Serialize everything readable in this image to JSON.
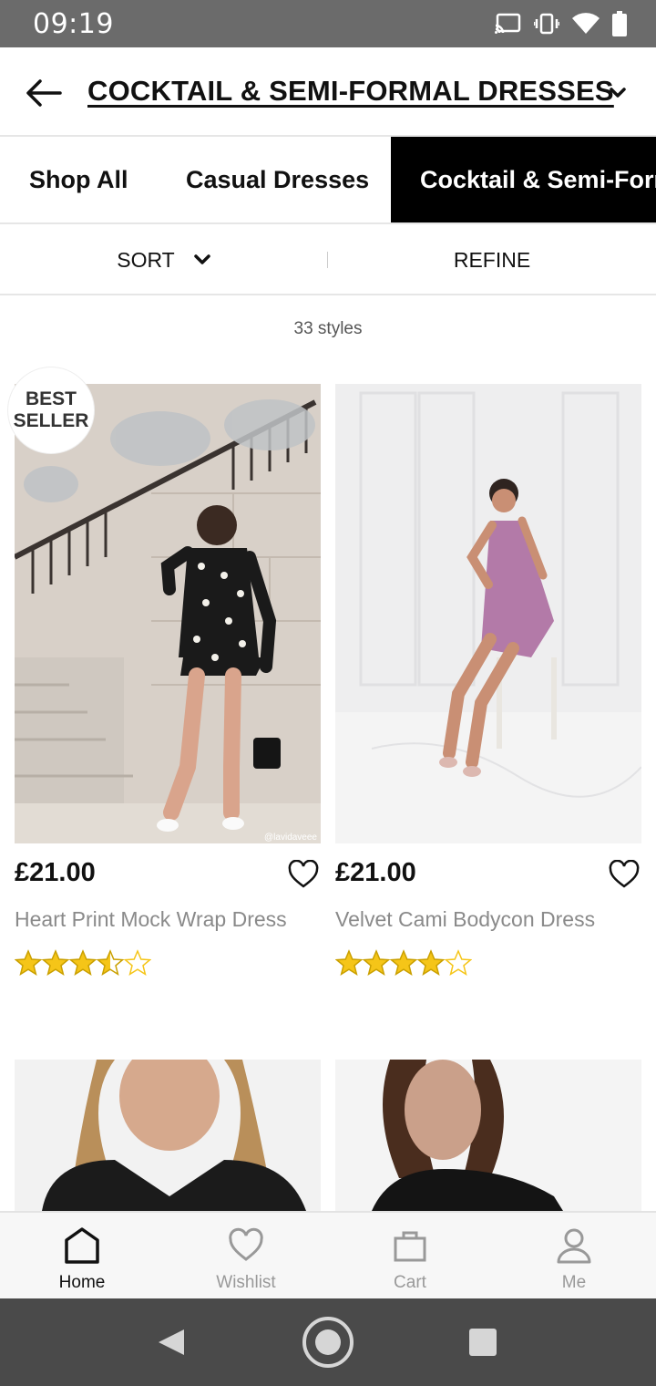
{
  "status": {
    "time": "09:19"
  },
  "header": {
    "title": "COCKTAIL & SEMI-FORMAL DRESSES"
  },
  "tabs": [
    {
      "label": "Shop All"
    },
    {
      "label": "Casual Dresses"
    },
    {
      "label": "Cocktail & Semi-Formal Dresses"
    }
  ],
  "filters": {
    "sort_label": "SORT",
    "refine_label": "REFINE"
  },
  "results": {
    "count_text": "33 styles"
  },
  "badge": {
    "line1": "BEST",
    "line2": "SELLER"
  },
  "products": [
    {
      "price": "£21.00",
      "name": "Heart Print Mock Wrap Dress",
      "rating": 3.5,
      "photo_credit": "@lavidaveee"
    },
    {
      "price": "£21.00",
      "name": "Velvet Cami Bodycon Dress",
      "rating": 4
    }
  ],
  "bottom_nav": [
    {
      "label": "Home",
      "icon": "home-icon",
      "active": true
    },
    {
      "label": "Wishlist",
      "icon": "heart-icon",
      "active": false
    },
    {
      "label": "Cart",
      "icon": "bag-icon",
      "active": false
    },
    {
      "label": "Me",
      "icon": "user-icon",
      "active": false
    }
  ],
  "colors": {
    "star": "#f5c518",
    "active_tab_bg": "#000000",
    "status_bar": "#6b6b6b"
  }
}
